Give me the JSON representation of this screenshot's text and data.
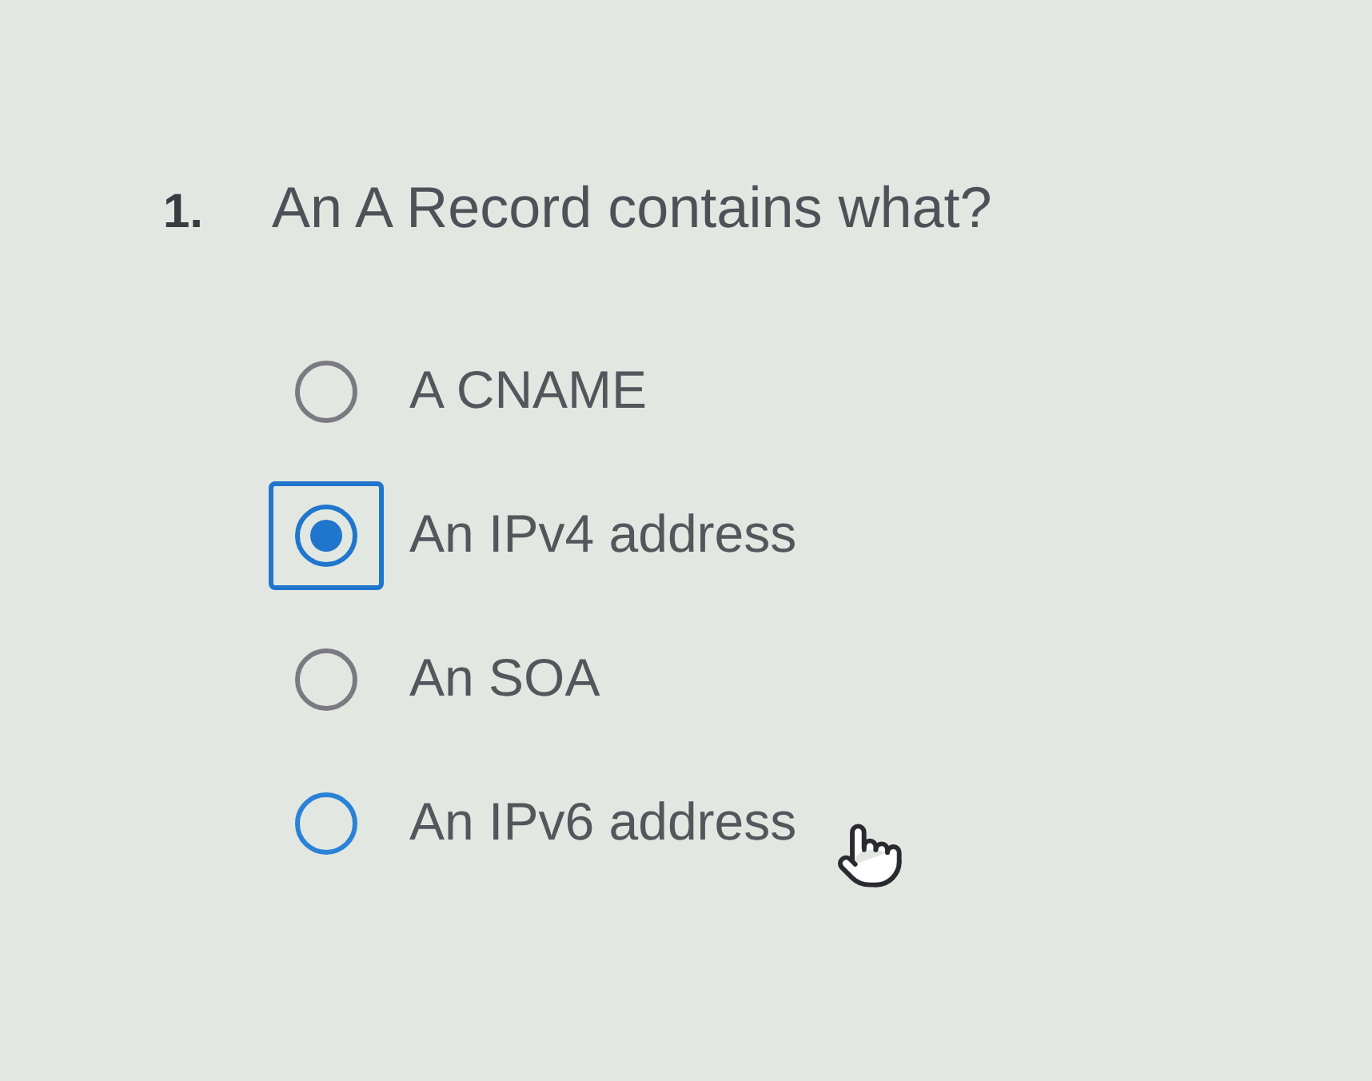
{
  "question": {
    "number": "1.",
    "text": "An A Record contains what?"
  },
  "options": [
    {
      "label": "A CNAME",
      "selected": false,
      "focused": false,
      "hovered": false
    },
    {
      "label": "An IPv4 address",
      "selected": true,
      "focused": true,
      "hovered": false
    },
    {
      "label": "An SOA",
      "selected": false,
      "focused": false,
      "hovered": false
    },
    {
      "label": "An IPv6 address",
      "selected": false,
      "focused": false,
      "hovered": true
    }
  ]
}
